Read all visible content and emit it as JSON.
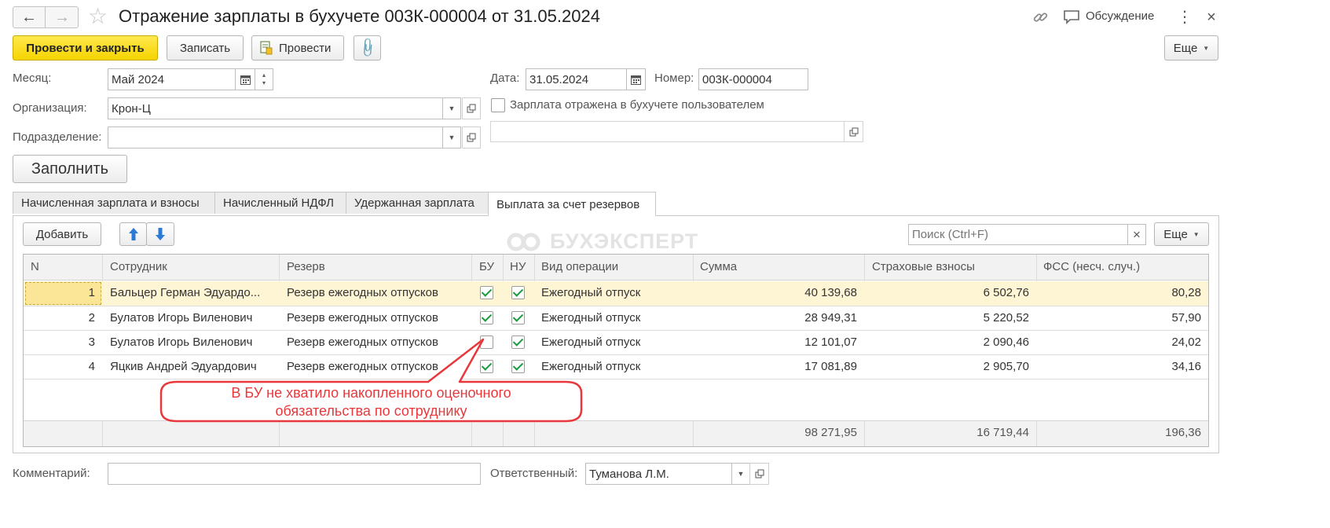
{
  "window": {
    "title": "Отражение зарплаты в бухучете 003К-000004 от 31.05.2024",
    "discussion_label": "Обсуждение"
  },
  "toolbar": {
    "post_close_label": "Провести и закрыть",
    "save_label": "Записать",
    "post_label": "Провести",
    "more_label": "Еще"
  },
  "form": {
    "month_label": "Месяц:",
    "month_value": "Май 2024",
    "org_label": "Организация:",
    "org_value": "Крон-Ц",
    "dept_label": "Подразделение:",
    "dept_value": "",
    "date_label": "Дата:",
    "date_value": "31.05.2024",
    "number_label": "Номер:",
    "number_value": "003К-000004",
    "user_reflected_label": "Зарплата отражена в бухучете пользователем",
    "user_reflected_checked": false,
    "extra_value": "",
    "fill_label": "Заполнить"
  },
  "tabs": [
    {
      "label": "Начисленная зарплата и взносы",
      "active": false
    },
    {
      "label": "Начисленный НДФЛ",
      "active": false
    },
    {
      "label": "Удержанная зарплата",
      "active": false
    },
    {
      "label": "Выплата за счет резервов",
      "active": true
    }
  ],
  "table_toolbar": {
    "add_label": "Добавить",
    "search_placeholder": "Поиск (Ctrl+F)",
    "clear_glyph": "×",
    "more_label": "Еще"
  },
  "table": {
    "columns": [
      "N",
      "Сотрудник",
      "Резерв",
      "БУ",
      "НУ",
      "Вид операции",
      "Сумма",
      "Страховые взносы",
      "ФСС (несч. случ.)"
    ],
    "rows": [
      {
        "n": "1",
        "employee": "Бальцер Герман Эдуардо...",
        "reserve": "Резерв ежегодных отпусков",
        "bu": true,
        "nu": true,
        "operation": "Ежегодный отпуск",
        "sum": "40 139,68",
        "insurance": "6 502,76",
        "fss": "80,28"
      },
      {
        "n": "2",
        "employee": "Булатов Игорь Виленович",
        "reserve": "Резерв ежегодных отпусков",
        "bu": true,
        "nu": true,
        "operation": "Ежегодный отпуск",
        "sum": "28 949,31",
        "insurance": "5 220,52",
        "fss": "57,90"
      },
      {
        "n": "3",
        "employee": "Булатов Игорь Виленович",
        "reserve": "Резерв ежегодных отпусков",
        "bu": false,
        "nu": true,
        "operation": "Ежегодный отпуск",
        "sum": "12 101,07",
        "insurance": "2 090,46",
        "fss": "24,02"
      },
      {
        "n": "4",
        "employee": "Яцкив Андрей Эдуардович",
        "reserve": "Резерв ежегодных отпусков",
        "bu": true,
        "nu": true,
        "operation": "Ежегодный отпуск",
        "sum": "17 081,89",
        "insurance": "2 905,70",
        "fss": "34,16"
      }
    ],
    "totals": {
      "sum": "98 271,95",
      "insurance": "16 719,44",
      "fss": "196,36"
    }
  },
  "callout": {
    "line1": "В БУ не хватило накопленного оценочного",
    "line2": "обязательства по сотруднику"
  },
  "watermark": "БУХЭКСПЕРТ",
  "footer": {
    "comment_label": "Комментарий:",
    "comment_value": "",
    "responsible_label": "Ответственный:",
    "responsible_value": "Туманова Л.М."
  },
  "icons": {
    "back": "back-arrow-icon",
    "forward": "forward-arrow-icon",
    "favorite": "star-icon",
    "link": "link-icon",
    "discussion": "chat-icon",
    "menu": "kebab-icon",
    "close": "close-icon",
    "attach": "paperclip-icon",
    "calendar": "calendar-icon",
    "open": "open-window-icon",
    "move_up": "arrow-up-icon",
    "move_down": "arrow-down-icon"
  },
  "colors": {
    "primary_button": "#f5d400",
    "selected_row": "#fdf5d3",
    "selected_cell": "#fbe596",
    "callout_border": "#e8383b",
    "check": "#1a9b3f",
    "blue_arrow": "#2b7ad6"
  }
}
